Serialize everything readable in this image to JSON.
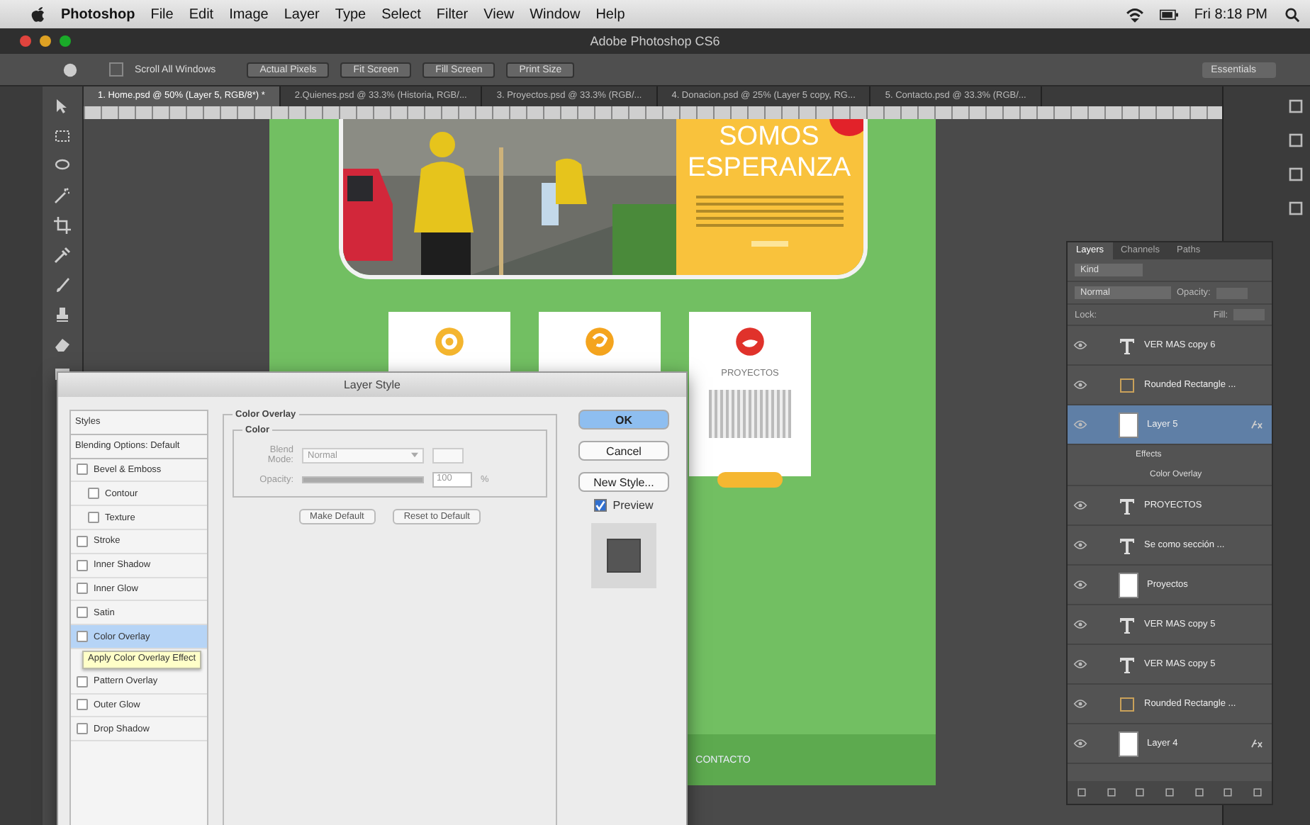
{
  "menu_bar": {
    "app": "Photoshop",
    "items": [
      "File",
      "Edit",
      "Image",
      "Layer",
      "Type",
      "Select",
      "Filter",
      "View",
      "Window",
      "Help"
    ],
    "clock": "Fri 8:18 PM"
  },
  "window": {
    "title": "Adobe Photoshop CS6"
  },
  "options_bar": {
    "scroll_all": {
      "label": "Scroll All Windows",
      "checked": false
    },
    "buttons": [
      "Actual Pixels",
      "Fit Screen",
      "Fill Screen",
      "Print Size"
    ],
    "workspace": "Essentials"
  },
  "tabs": [
    {
      "label": "1. Home.psd @ 50% (Layer 5, RGB/8*) *",
      "selected": true
    },
    {
      "label": "2.Quienes.psd @ 33.3% (Historia, RGB/...",
      "selected": false
    },
    {
      "label": "3. Proyectos.psd @ 33.3% (RGB/...",
      "selected": false
    },
    {
      "label": "4. Donacion.psd @ 25% (Layer 5 copy, RG...",
      "selected": false
    },
    {
      "label": "5. Contacto.psd @ 33.3% (RGB/...",
      "selected": false
    }
  ],
  "document": {
    "hero": {
      "heading": [
        "SOMOS",
        "ESPERANZA"
      ]
    },
    "cards": [
      {
        "kind": "icon"
      },
      {
        "kind": "icon"
      },
      {
        "kind": "detail",
        "title": "PROYECTOS"
      }
    ],
    "footer": "CONTACTO"
  },
  "layer_style": {
    "title": "Layer Style",
    "styles_header": "Styles",
    "blending": "Blending Options: Default",
    "effects": [
      {
        "label": "Bevel & Emboss",
        "checked": false,
        "selected": false,
        "children": [
          {
            "label": "Contour",
            "checked": false,
            "selected": false
          },
          {
            "label": "Texture",
            "checked": false,
            "selected": false
          }
        ]
      },
      {
        "label": "Stroke",
        "checked": false,
        "selected": false
      },
      {
        "label": "Inner Shadow",
        "checked": false,
        "selected": false
      },
      {
        "label": "Inner Glow",
        "checked": false,
        "selected": false
      },
      {
        "label": "Satin",
        "checked": false,
        "selected": false
      },
      {
        "label": "Color Overlay",
        "checked": false,
        "selected": true
      },
      {
        "label": "Pattern Overlay",
        "checked": false,
        "selected": false
      },
      {
        "label": "Outer Glow",
        "checked": false,
        "selected": false
      },
      {
        "label": "Drop Shadow",
        "checked": false,
        "selected": false
      }
    ],
    "tooltip": "Apply Color Overlay Effect",
    "panel": {
      "title": "Color Overlay",
      "group": "Color",
      "blend_label": "Blend Mode:",
      "blend_mode": "Normal",
      "opacity_label": "Opacity:",
      "opacity": {
        "level": 1
      },
      "opacity_value": "100",
      "unit": "%",
      "buttons": [
        "Make Default",
        "Reset to Default"
      ]
    },
    "actions": [
      {
        "label": "OK",
        "default": true
      },
      {
        "label": "Cancel",
        "default": false
      },
      {
        "label": "New Style...",
        "default": false
      }
    ],
    "preview": {
      "label": "Preview",
      "checked": true
    }
  },
  "layers_panel": {
    "tabs": [
      {
        "label": "Layers",
        "selected": true
      },
      {
        "label": "Channels",
        "selected": false
      },
      {
        "label": "Paths",
        "selected": false
      }
    ],
    "filter": "Kind",
    "blend_mode": "Normal",
    "opacity_label": "Opacity:",
    "lock_label": "Lock:",
    "fill_label": "Fill:",
    "layers": [
      {
        "kind": "text",
        "name": "VER MAS copy 6",
        "visible": true,
        "selected": false,
        "fx": false
      },
      {
        "kind": "shape",
        "name": "Rounded Rectangle ...",
        "visible": true,
        "selected": false,
        "fx": false
      },
      {
        "name": "Layer 5",
        "visible": true,
        "selected": true,
        "fx": true,
        "effects": {
          "label": "Effects",
          "items": [
            "Color Overlay"
          ]
        }
      },
      {
        "kind": "text",
        "name": "PROYECTOS",
        "visible": true,
        "selected": false,
        "fx": false
      },
      {
        "kind": "text",
        "name": "Se como sección ...",
        "visible": true,
        "selected": false,
        "fx": false
      },
      {
        "name": "Proyectos",
        "visible": true,
        "selected": false,
        "fx": false
      },
      {
        "kind": "text",
        "name": "VER MAS copy 5",
        "visible": true,
        "selected": false,
        "fx": false
      },
      {
        "kind": "text",
        "name": "VER MAS copy 5",
        "visible": true,
        "selected": false,
        "fx": false
      },
      {
        "kind": "shape",
        "name": "Rounded Rectangle ...",
        "visible": true,
        "selected": false,
        "fx": false
      },
      {
        "name": "Layer 4",
        "visible": true,
        "selected": false,
        "fx": true
      }
    ]
  }
}
